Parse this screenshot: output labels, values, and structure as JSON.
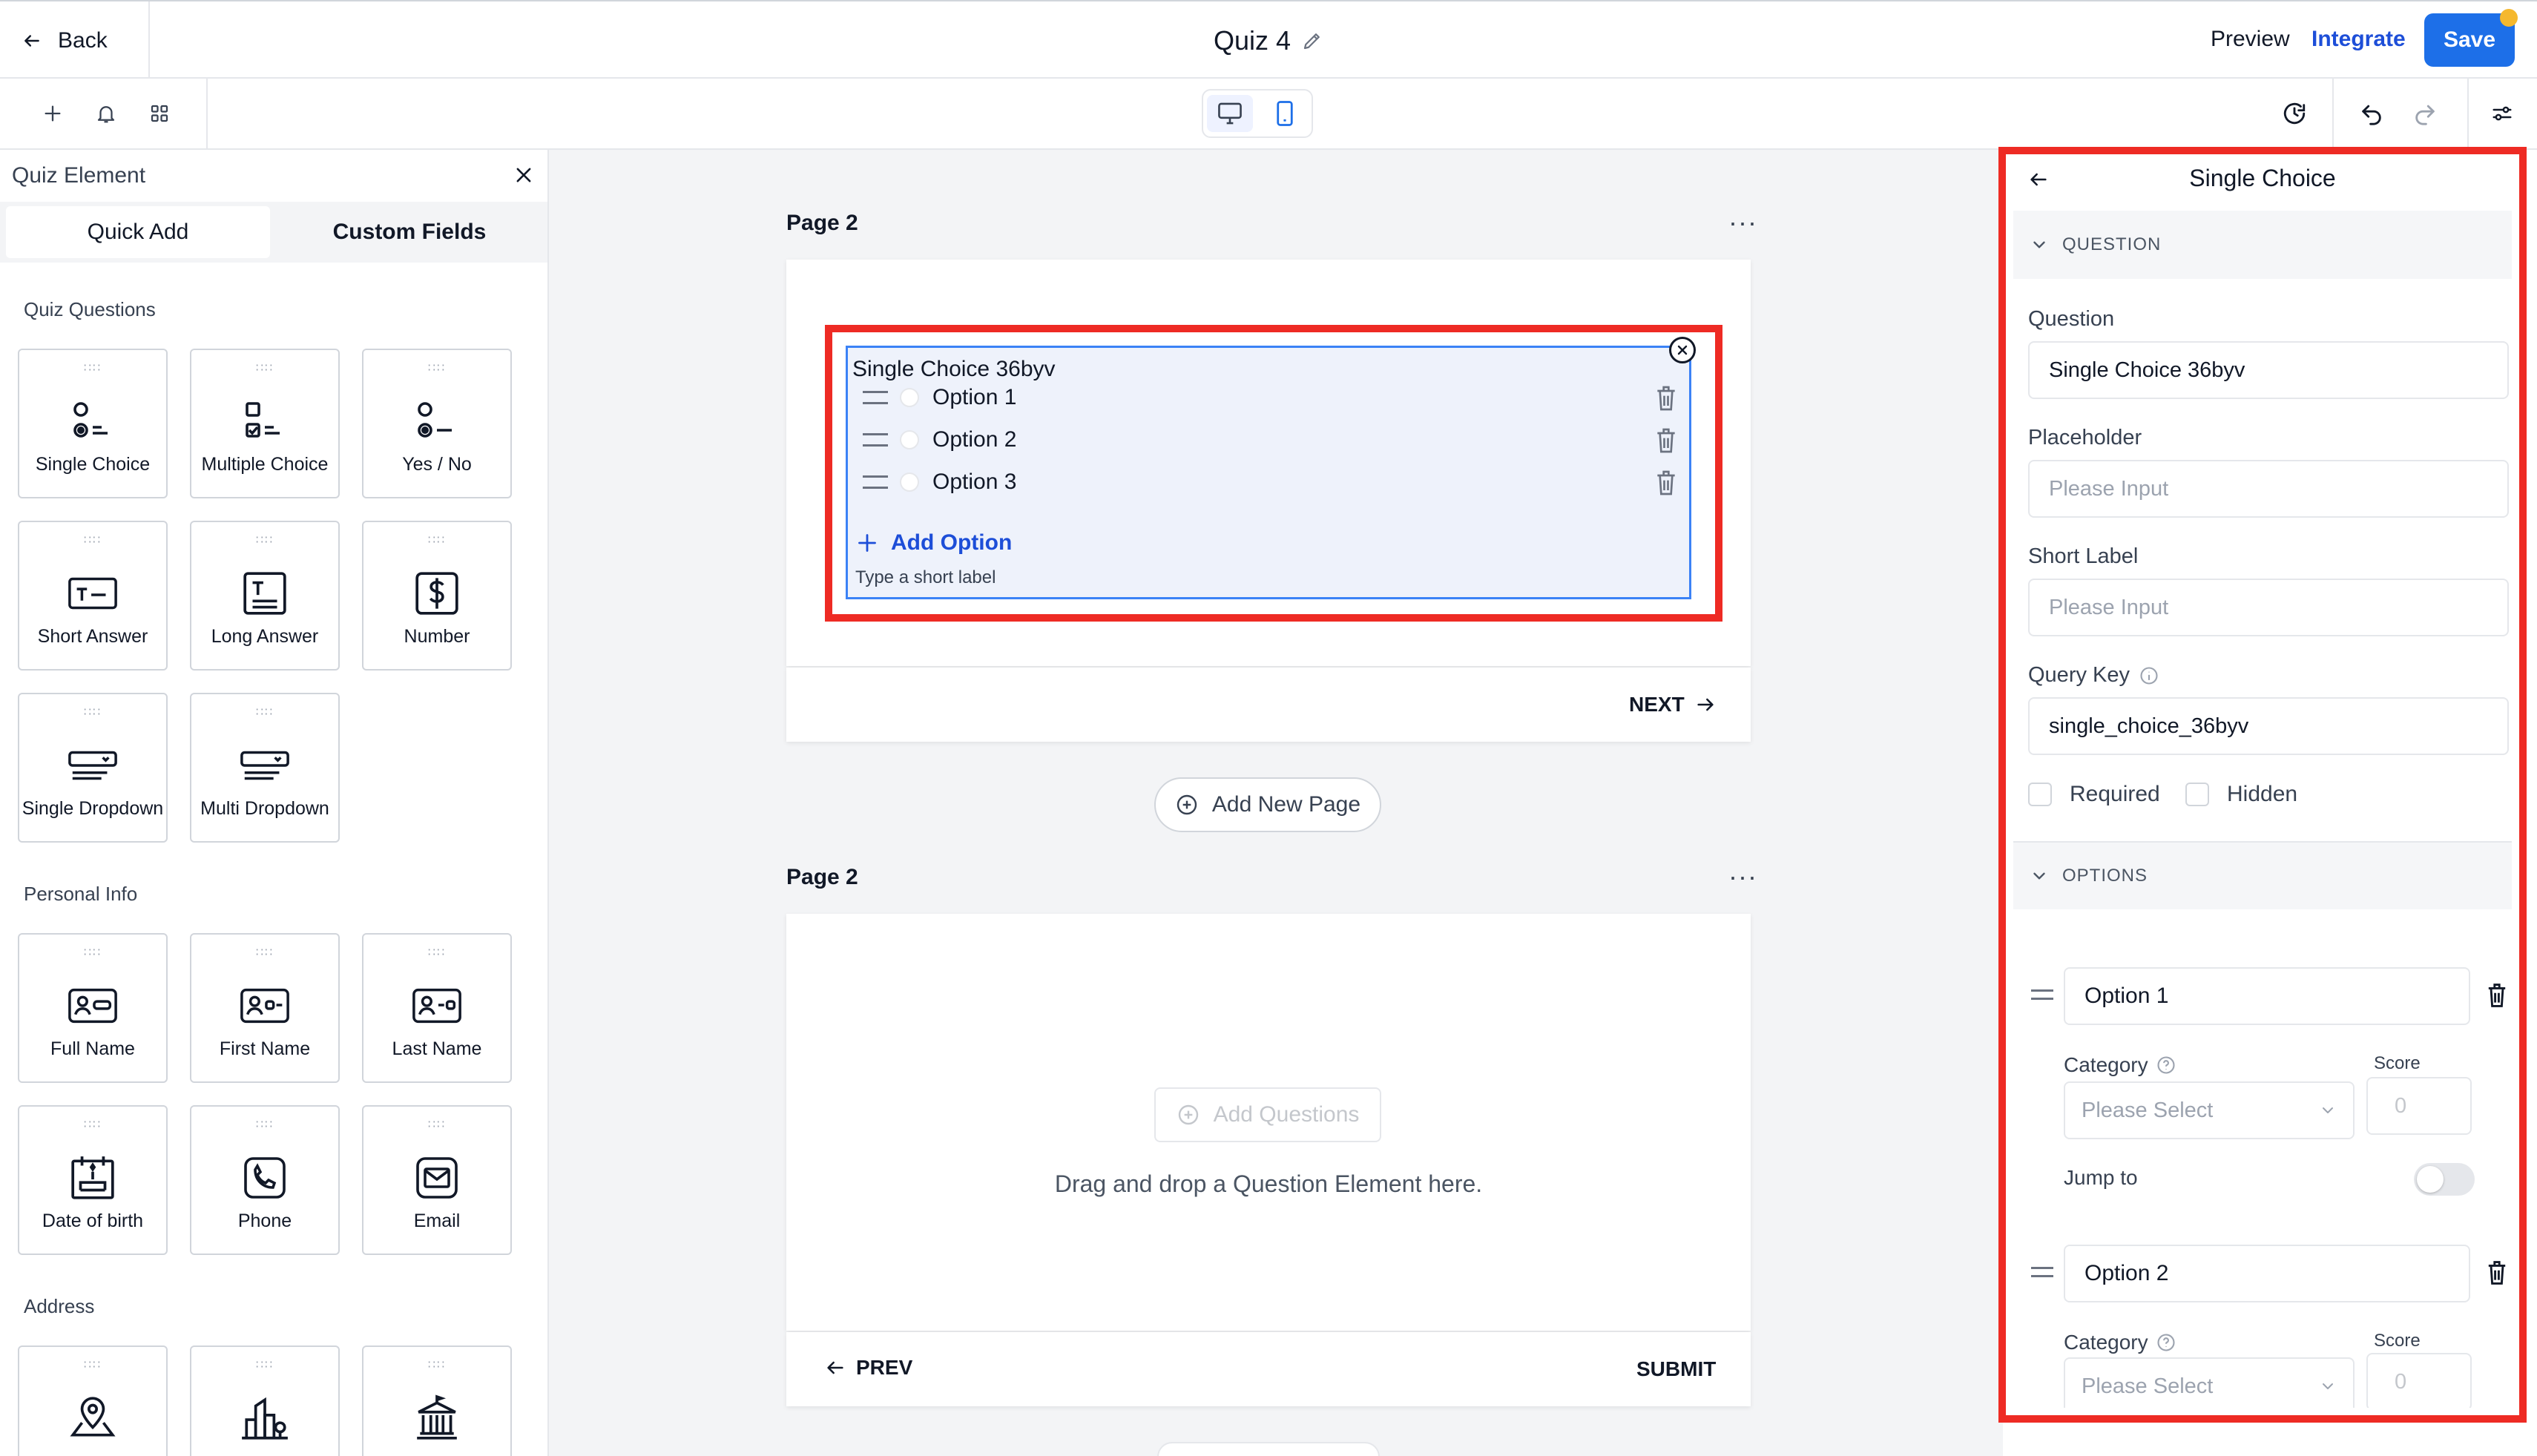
{
  "header": {
    "back_label": "Back",
    "quiz_title": "Quiz 4",
    "preview_label": "Preview",
    "integrate_label": "Integrate",
    "save_label": "Save"
  },
  "toolbar": {
    "left_icons": [
      "plus-icon",
      "bell-icon",
      "grid-icon"
    ],
    "device_modes": [
      "desktop-icon",
      "mobile-icon"
    ],
    "right_icons": [
      "history-icon",
      "undo-icon",
      "redo-icon",
      "settings-sliders-icon"
    ]
  },
  "left_panel": {
    "title": "Quiz Element",
    "tabs": [
      {
        "label": "Quick Add",
        "active": true
      },
      {
        "label": "Custom Fields",
        "active": false
      }
    ],
    "sections": [
      {
        "heading": "Quiz Questions",
        "items": [
          {
            "label": "Single Choice",
            "icon": "single-choice-icon"
          },
          {
            "label": "Multiple Choice",
            "icon": "multiple-choice-icon"
          },
          {
            "label": "Yes / No",
            "icon": "yes-no-icon"
          },
          {
            "label": "Short Answer",
            "icon": "short-answer-icon"
          },
          {
            "label": "Long Answer",
            "icon": "long-answer-icon"
          },
          {
            "label": "Number",
            "icon": "number-icon"
          },
          {
            "label": "Single Dropdown",
            "icon": "single-dropdown-icon"
          },
          {
            "label": "Multi Dropdown",
            "icon": "multi-dropdown-icon"
          }
        ]
      },
      {
        "heading": "Personal Info",
        "items": [
          {
            "label": "Full Name",
            "icon": "full-name-icon"
          },
          {
            "label": "First Name",
            "icon": "first-name-icon"
          },
          {
            "label": "Last Name",
            "icon": "last-name-icon"
          },
          {
            "label": "Date of birth",
            "icon": "birthday-cake-icon"
          },
          {
            "label": "Phone",
            "icon": "phone-icon"
          },
          {
            "label": "Email",
            "icon": "email-icon"
          }
        ]
      },
      {
        "heading": "Address",
        "items": [
          {
            "label": "",
            "icon": "map-pin-icon"
          },
          {
            "label": "",
            "icon": "city-icon"
          },
          {
            "label": "",
            "icon": "state-building-icon"
          }
        ]
      }
    ]
  },
  "canvas": {
    "page1": {
      "label": "Page 2",
      "question": {
        "title": "Single Choice 36byv",
        "options": [
          "Option 1",
          "Option 2",
          "Option 3"
        ],
        "add_option_label": "Add Option",
        "short_label_placeholder": "Type a short label"
      },
      "next_label": "NEXT"
    },
    "add_page_label": "Add New Page",
    "page2": {
      "label": "Page 2",
      "add_questions_label": "Add Questions",
      "drop_hint": "Drag and drop a Question Element here.",
      "prev_label": "PREV",
      "submit_label": "SUBMIT"
    }
  },
  "right_panel": {
    "title": "Single Choice",
    "question_section": "QUESTION",
    "question_label": "Question",
    "question_value": "Single Choice 36byv",
    "placeholder_label": "Placeholder",
    "placeholder_hint": "Please Input",
    "short_label_label": "Short Label",
    "short_label_hint": "Please Input",
    "query_key_label": "Query Key",
    "query_key_value": "single_choice_36byv",
    "required_label": "Required",
    "hidden_label": "Hidden",
    "options_section": "OPTIONS",
    "options": [
      {
        "value": "Option 1",
        "category_label": "Category",
        "category_hint": "Please Select",
        "score_label": "Score",
        "score_hint": "0",
        "jump_label": "Jump to",
        "jump_enabled": false
      },
      {
        "value": "Option 2",
        "category_label": "Category",
        "category_hint": "Please Select",
        "score_label": "Score",
        "score_hint": "0"
      }
    ]
  },
  "colors": {
    "accent": "#1d6fe8",
    "highlight": "#ee2b24",
    "link": "#1d4ed8",
    "notification": "#f5b82e"
  }
}
